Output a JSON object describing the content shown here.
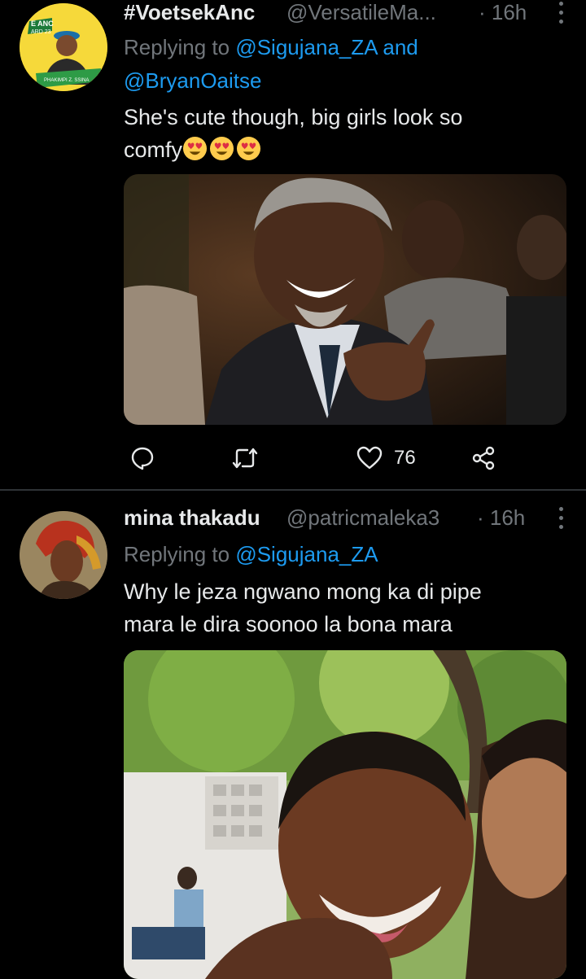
{
  "tweets": [
    {
      "display_name": "#VoetsekAnc",
      "handle": "@VersatileMa...",
      "time": "· 16h",
      "replying_prefix": "Replying to",
      "replying_to_1": "@Sigujana_ZA",
      "replying_joiner": "and",
      "replying_to_2": "@BryanOaitse",
      "text_line_1": "She's cute though, big girls look so",
      "text_line_2": "comfy",
      "emoji": [
        "smiling-face-with-heart-eyes",
        "smiling-face-with-heart-eyes",
        "smiling-face-with-heart-eyes"
      ],
      "avatar_badge_top": "E ANC",
      "avatar_badge_sub": "ARD 23",
      "avatar_banner": "PHAKIMPI Z. SSINA",
      "likes": "76"
    },
    {
      "display_name": "mina thakadu",
      "handle": "@patricmaleka3",
      "time": "· 16h",
      "replying_prefix": "Replying to",
      "replying_to_1": "@Sigujana_ZA",
      "text_line_1": "Why le jeza ngwano mong ka di pipe",
      "text_line_2": "mara le dira soonoo la bona mara"
    }
  ],
  "icons": {
    "reply": "speech-bubble-icon",
    "retweet": "retweet-icon",
    "like": "heart-icon",
    "share": "share-icon",
    "more": "more-vertical-icon"
  },
  "colors": {
    "background": "#000000",
    "text": "#e7e9ea",
    "muted": "#71767b",
    "link": "#1d9bf0",
    "divider": "#2f3336"
  }
}
